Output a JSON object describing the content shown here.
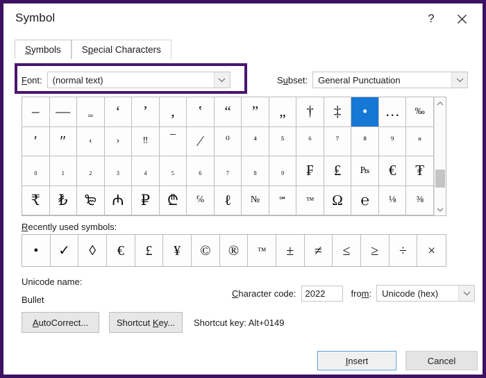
{
  "window": {
    "title": "Symbol",
    "help_icon": "question-mark-icon",
    "close_icon": "close-icon"
  },
  "tabs": [
    {
      "label": "Symbols",
      "accel": "S",
      "active": true
    },
    {
      "label": "Special Characters",
      "accel": "p",
      "active": false
    }
  ],
  "font_field": {
    "label": "Font:",
    "accel": "F",
    "value": "(normal text)",
    "dropdown_icon": "chevron-down-icon",
    "highlight_color": "#4a166f"
  },
  "subset_field": {
    "label": "Subset:",
    "accel": "u",
    "value": "General Punctuation",
    "dropdown_icon": "chevron-down-icon"
  },
  "symbol_grid": {
    "columns": 15,
    "rows": 4,
    "selected_index": 12,
    "selection_color": "#1578d5",
    "cells": [
      {
        "glyph": "–",
        "name": "en-dash"
      },
      {
        "glyph": "—",
        "name": "em-dash"
      },
      {
        "glyph": "‗",
        "name": "double-low-line",
        "size": "small"
      },
      {
        "glyph": "‘",
        "name": "left-single-quotation-mark"
      },
      {
        "glyph": "’",
        "name": "right-single-quotation-mark"
      },
      {
        "glyph": "‚",
        "name": "single-low-quotation-mark"
      },
      {
        "glyph": "‛",
        "name": "single-high-reversed-quotation-mark"
      },
      {
        "glyph": "“",
        "name": "left-double-quotation-mark"
      },
      {
        "glyph": "”",
        "name": "right-double-quotation-mark"
      },
      {
        "glyph": "„",
        "name": "double-low-quotation-mark"
      },
      {
        "glyph": "†",
        "name": "dagger"
      },
      {
        "glyph": "‡",
        "name": "double-dagger"
      },
      {
        "glyph": "•",
        "name": "bullet"
      },
      {
        "glyph": "…",
        "name": "horizontal-ellipsis"
      },
      {
        "glyph": "‰",
        "name": "per-mille-sign",
        "size": "small"
      },
      {
        "glyph": "′",
        "name": "prime"
      },
      {
        "glyph": "″",
        "name": "double-prime"
      },
      {
        "glyph": "‹",
        "name": "single-left-angle-quotation-mark",
        "size": "small"
      },
      {
        "glyph": "›",
        "name": "single-right-angle-quotation-mark",
        "size": "small"
      },
      {
        "glyph": "‼",
        "name": "double-exclamation-mark",
        "size": "small"
      },
      {
        "glyph": "‾",
        "name": "overline"
      },
      {
        "glyph": "⁄",
        "name": "fraction-slash"
      },
      {
        "glyph": "⁰",
        "name": "superscript-zero",
        "size": "small"
      },
      {
        "glyph": "⁴",
        "name": "superscript-four",
        "size": "small"
      },
      {
        "glyph": "⁵",
        "name": "superscript-five",
        "size": "small"
      },
      {
        "glyph": "⁶",
        "name": "superscript-six",
        "size": "small"
      },
      {
        "glyph": "⁷",
        "name": "superscript-seven",
        "size": "small"
      },
      {
        "glyph": "⁸",
        "name": "superscript-eight",
        "size": "small"
      },
      {
        "glyph": "⁹",
        "name": "superscript-nine",
        "size": "small"
      },
      {
        "glyph": "ⁿ",
        "name": "superscript-latin-small-letter-n",
        "size": "small"
      },
      {
        "glyph": "₀",
        "name": "subscript-zero",
        "size": "small"
      },
      {
        "glyph": "₁",
        "name": "subscript-one",
        "size": "small"
      },
      {
        "glyph": "₂",
        "name": "subscript-two",
        "size": "small"
      },
      {
        "glyph": "₃",
        "name": "subscript-three",
        "size": "small"
      },
      {
        "glyph": "₄",
        "name": "subscript-four",
        "size": "small"
      },
      {
        "glyph": "₅",
        "name": "subscript-five",
        "size": "small"
      },
      {
        "glyph": "₆",
        "name": "subscript-six",
        "size": "small"
      },
      {
        "glyph": "₇",
        "name": "subscript-seven",
        "size": "small"
      },
      {
        "glyph": "₈",
        "name": "subscript-eight",
        "size": "small"
      },
      {
        "glyph": "₉",
        "name": "subscript-nine",
        "size": "small"
      },
      {
        "glyph": "₣",
        "name": "french-franc-sign"
      },
      {
        "glyph": "₤",
        "name": "lira-sign"
      },
      {
        "glyph": "₧",
        "name": "peseta-sign",
        "size": "small"
      },
      {
        "glyph": "€",
        "name": "euro-sign"
      },
      {
        "glyph": "₮",
        "name": "tugrik-sign"
      },
      {
        "glyph": "₹",
        "name": "indian-rupee-sign"
      },
      {
        "glyph": "₺",
        "name": "turkish-lira-sign"
      },
      {
        "glyph": "₻",
        "name": "nordic-mark-sign"
      },
      {
        "glyph": "₼",
        "name": "manat-sign"
      },
      {
        "glyph": "₽",
        "name": "ruble-sign"
      },
      {
        "glyph": "₾",
        "name": "lari-sign"
      },
      {
        "glyph": "℅",
        "name": "care-of-sign",
        "size": "small"
      },
      {
        "glyph": "ℓ",
        "name": "script-small-l"
      },
      {
        "glyph": "№",
        "name": "numero-sign",
        "size": "small"
      },
      {
        "glyph": "℠",
        "name": "service-mark",
        "size": "tiny"
      },
      {
        "glyph": "™",
        "name": "trade-mark-sign",
        "size": "tiny"
      },
      {
        "glyph": "Ω",
        "name": "ohm-sign"
      },
      {
        "glyph": "℮",
        "name": "estimated-symbol"
      },
      {
        "glyph": "⅛",
        "name": "vulgar-fraction-one-eighth",
        "size": "small"
      },
      {
        "glyph": "⅜",
        "name": "vulgar-fraction-three-eighths",
        "size": "small"
      }
    ],
    "scrollbar": {
      "up_icon": "chevron-up-icon",
      "down_icon": "chevron-down-icon"
    }
  },
  "recent": {
    "label": "Recently used symbols:",
    "accel": "R",
    "cells": [
      {
        "glyph": "•",
        "name": "bullet"
      },
      {
        "glyph": "✓",
        "name": "check-mark"
      },
      {
        "glyph": "◊",
        "name": "lozenge"
      },
      {
        "glyph": "€",
        "name": "euro-sign"
      },
      {
        "glyph": "£",
        "name": "pound-sign"
      },
      {
        "glyph": "¥",
        "name": "yen-sign"
      },
      {
        "glyph": "©",
        "name": "copyright-sign"
      },
      {
        "glyph": "®",
        "name": "registered-sign"
      },
      {
        "glyph": "™",
        "name": "trade-mark-sign",
        "size": "small"
      },
      {
        "glyph": "±",
        "name": "plus-minus-sign"
      },
      {
        "glyph": "≠",
        "name": "not-equal-to"
      },
      {
        "glyph": "≤",
        "name": "less-than-or-equal-to"
      },
      {
        "glyph": "≥",
        "name": "greater-than-or-equal-to"
      },
      {
        "glyph": "÷",
        "name": "division-sign"
      },
      {
        "glyph": "×",
        "name": "multiplication-sign"
      }
    ]
  },
  "unicode_name": {
    "label": "Unicode name:",
    "value": "Bullet"
  },
  "character_code": {
    "label": "Character code:",
    "accel": "C",
    "value": "2022"
  },
  "from_field": {
    "label": "from:",
    "accel": "m",
    "value": "Unicode (hex)",
    "dropdown_icon": "chevron-down-icon"
  },
  "buttons": {
    "autocorrect": {
      "label": "AutoCorrect...",
      "accel": "A"
    },
    "shortcut_key": {
      "label": "Shortcut Key...",
      "accel": "K"
    },
    "insert": {
      "label": "Insert",
      "accel": "I"
    },
    "cancel": {
      "label": "Cancel"
    }
  },
  "shortcut_key_status": "Shortcut key: Alt+0149"
}
